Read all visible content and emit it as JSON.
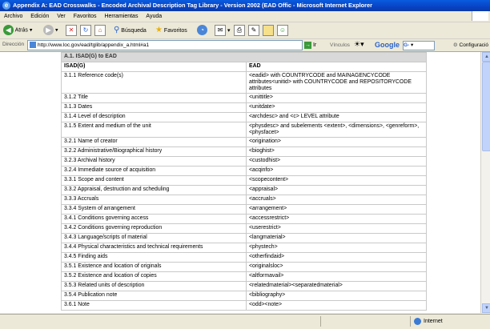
{
  "window": {
    "title": "Appendix A: EAD Crosswalks - Encoded Archival Description Tag Library - Version 2002 (EAD Offic - Microsoft Internet Explorer"
  },
  "menu": [
    "Archivo",
    "Edición",
    "Ver",
    "Favoritos",
    "Herramientas",
    "Ayuda"
  ],
  "toolbar": {
    "back_label": "Atrás",
    "search_label": "Búsqueda",
    "favorites_label": "Favoritos"
  },
  "address": {
    "label": "Dirección",
    "url": "http://www.loc.gov/ead/tglib/appendix_a.html#a1",
    "go_label": "Ir",
    "links_label": "Vínculos",
    "google_label": "Google",
    "google_box": "G-",
    "config_label": "Configuració"
  },
  "table": {
    "caption": "A.1. ISAD(G) to EAD",
    "headers": [
      "ISAD(G)",
      "EAD"
    ],
    "rows": [
      [
        "3.1.1 Reference code(s)",
        "<eadid> with COUNTRYCODE and MAINAGENCYCODE attributes<unitid> with COUNTRYCODE and REPOSITORYCODE attributes"
      ],
      [
        "3.1.2 Title",
        "<unittitle>"
      ],
      [
        "3.1.3 Dates",
        "<unitdate>"
      ],
      [
        "3.1.4 Level of description",
        "<archdesc> and <c> LEVEL attribute"
      ],
      [
        "3.1.5 Extent and medium of the unit",
        "<physdesc> and subelements <extent>, <dimensions>, <genreform>, <physfacet>"
      ],
      [
        "3.2.1 Name of creator",
        "<origination>"
      ],
      [
        "3.2.2 Administrative/Biographical history",
        "<bioghist>"
      ],
      [
        "3.2.3 Archival history",
        "<custodhist>"
      ],
      [
        "3.2.4 Immediate source of acquisition",
        "<acqinfo>"
      ],
      [
        "3.3.1 Scope and content",
        "<scopecontent>"
      ],
      [
        "3.3.2 Appraisal, destruction and scheduling",
        "<appraisal>"
      ],
      [
        "3.3.3 Accruals",
        "<accruals>"
      ],
      [
        "3.3.4 System of arrangement",
        "<arrangement>"
      ],
      [
        "3.4.1 Conditions governing access",
        "<accessrestrict>"
      ],
      [
        "3.4.2 Conditions governing reproduction",
        "<userestrict>"
      ],
      [
        "3.4.3 Language/scripts of material",
        "<langmaterial>"
      ],
      [
        "3.4.4 Physical characteristics and technical requirements",
        "<phystech>"
      ],
      [
        "3.4.5 Finding aids",
        "<otherfindaid>"
      ],
      [
        "3.5.1 Existence and location of originals",
        "<originalsloc>"
      ],
      [
        "3.5.2 Existence and location of copies",
        "<altformavail>"
      ],
      [
        "3.5.3 Related units of description",
        "<relatedmaterial><separatedmaterial>"
      ],
      [
        "3.5.4 Publication note",
        "<bibliography>"
      ],
      [
        "3.6.1 Note",
        "<odd><note>"
      ]
    ]
  },
  "status": {
    "zone": "Internet"
  },
  "icons": {
    "back": "back-arrow-icon",
    "forward": "forward-arrow-icon",
    "stop": "stop-icon",
    "refresh": "refresh-icon",
    "home": "home-icon",
    "search": "search-icon",
    "favorites": "star-icon",
    "history": "history-icon",
    "mail": "mail-icon",
    "print": "print-icon",
    "edit": "edit-icon",
    "messenger": "messenger-icon"
  },
  "colors": {
    "titlebar": "#0a4fd8",
    "chrome": "#ece9d8",
    "table_caption_bg": "#d9d9d9"
  }
}
